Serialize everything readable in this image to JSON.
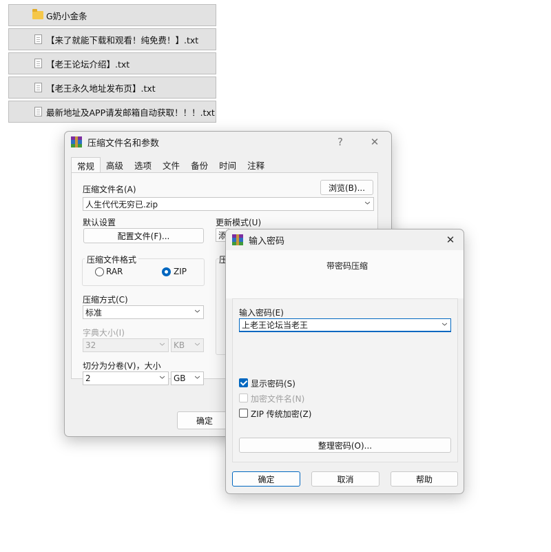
{
  "files": [
    {
      "name": "G奶小金条",
      "icon": "folder-icon"
    },
    {
      "name": "【来了就能下载和观看！纯免费！】.txt",
      "icon": "text-file-icon"
    },
    {
      "name": "【老王论坛介绍】.txt",
      "icon": "text-file-icon"
    },
    {
      "name": "【老王永久地址发布页】.txt",
      "icon": "text-file-icon"
    },
    {
      "name": "最新地址及APP请发邮箱自动获取！！！.txt",
      "icon": "text-file-icon"
    }
  ],
  "archive_dialog": {
    "title": "压缩文件名和参数",
    "help": "?",
    "close": "✕",
    "tabs": [
      "常规",
      "高级",
      "选项",
      "文件",
      "备份",
      "时间",
      "注释"
    ],
    "archive_name_label": "压缩文件名(A)",
    "browse_label": "浏览(B)...",
    "archive_name_value": "人生代代无穷已.zip",
    "default_settings_label": "默认设置",
    "profiles_label": "配置文件(F)...",
    "update_mode_label": "更新模式(U)",
    "update_mode_value": "添",
    "format_group_label": "压缩文件格式",
    "format_rar": "RAR",
    "format_zip": "ZIP",
    "options_group_label": "压",
    "method_label": "压缩方式(C)",
    "method_value": "标准",
    "dict_label": "字典大小(I)",
    "dict_value": "32",
    "dict_unit": "KB",
    "split_label": "切分为分卷(V)，大小",
    "split_value": "2",
    "split_unit": "GB",
    "ok_label": "确定"
  },
  "password_dialog": {
    "title": "输入密码",
    "close": "✕",
    "heading": "带密码压缩",
    "password_label": "输入密码(E)",
    "password_value": "上老王论坛当老王",
    "show_password": "显示密码(S)",
    "encrypt_names": "加密文件名(N)",
    "zip_legacy": "ZIP 传统加密(Z)",
    "organize_label": "整理密码(O)...",
    "ok_label": "确定",
    "cancel_label": "取消",
    "help_label": "帮助"
  },
  "colors": {
    "accent": "#0067c0"
  }
}
